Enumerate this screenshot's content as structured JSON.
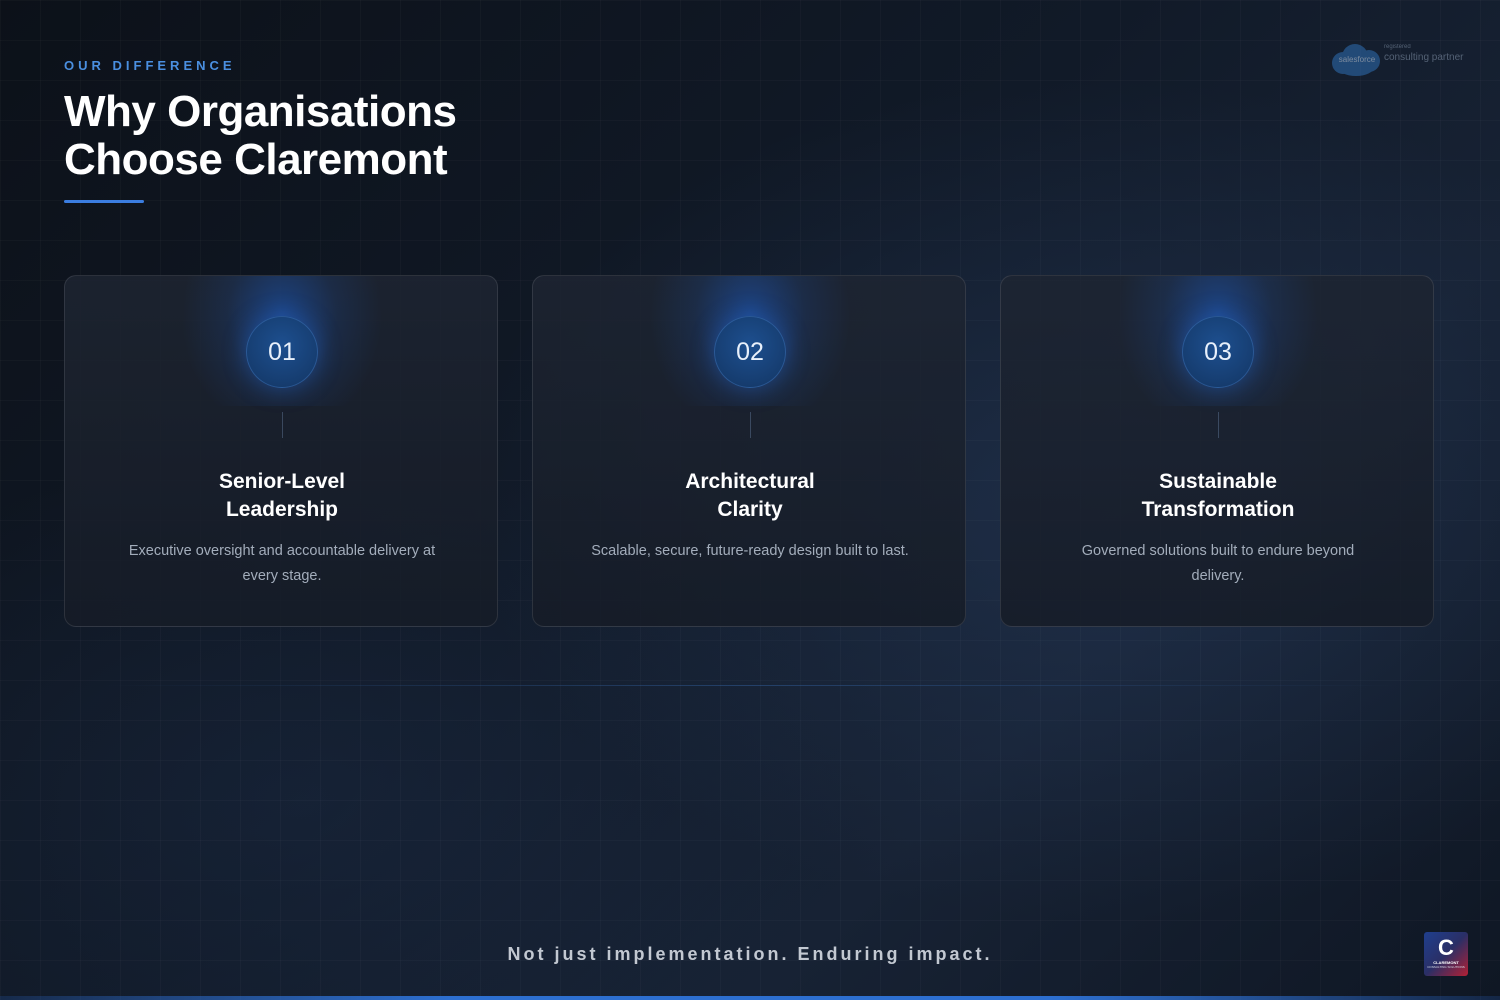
{
  "header": {
    "eyebrow": "OUR DIFFERENCE",
    "title_line1": "Why Organisations",
    "title_line2": "Choose Claremont"
  },
  "partner_badge": {
    "brand": "salesforce",
    "small_text": "registered",
    "main_text": "consulting partner",
    "icon": "salesforce-cloud-icon"
  },
  "cards": [
    {
      "number": "01",
      "title_line1": "Senior-Level",
      "title_line2": "Leadership",
      "description": "Executive oversight and accountable delivery at every stage."
    },
    {
      "number": "02",
      "title_line1": "Architectural",
      "title_line2": "Clarity",
      "description": "Scalable, secure, future-ready design built to last."
    },
    {
      "number": "03",
      "title_line1": "Sustainable",
      "title_line2": "Transformation",
      "description": "Governed solutions built to endure beyond delivery."
    }
  ],
  "footer": {
    "tagline": "Not just implementation. Enduring impact.",
    "logo": {
      "icon": "claremont-logo-icon",
      "mark": "C",
      "wordmark": "CLAREMONT",
      "subtext": "CONSULTING SOLUTIONS"
    }
  },
  "colors": {
    "accent": "#4a8fe0",
    "underline": "#3b7de0",
    "badge": "#1d4f8f",
    "background": "#111a28"
  }
}
